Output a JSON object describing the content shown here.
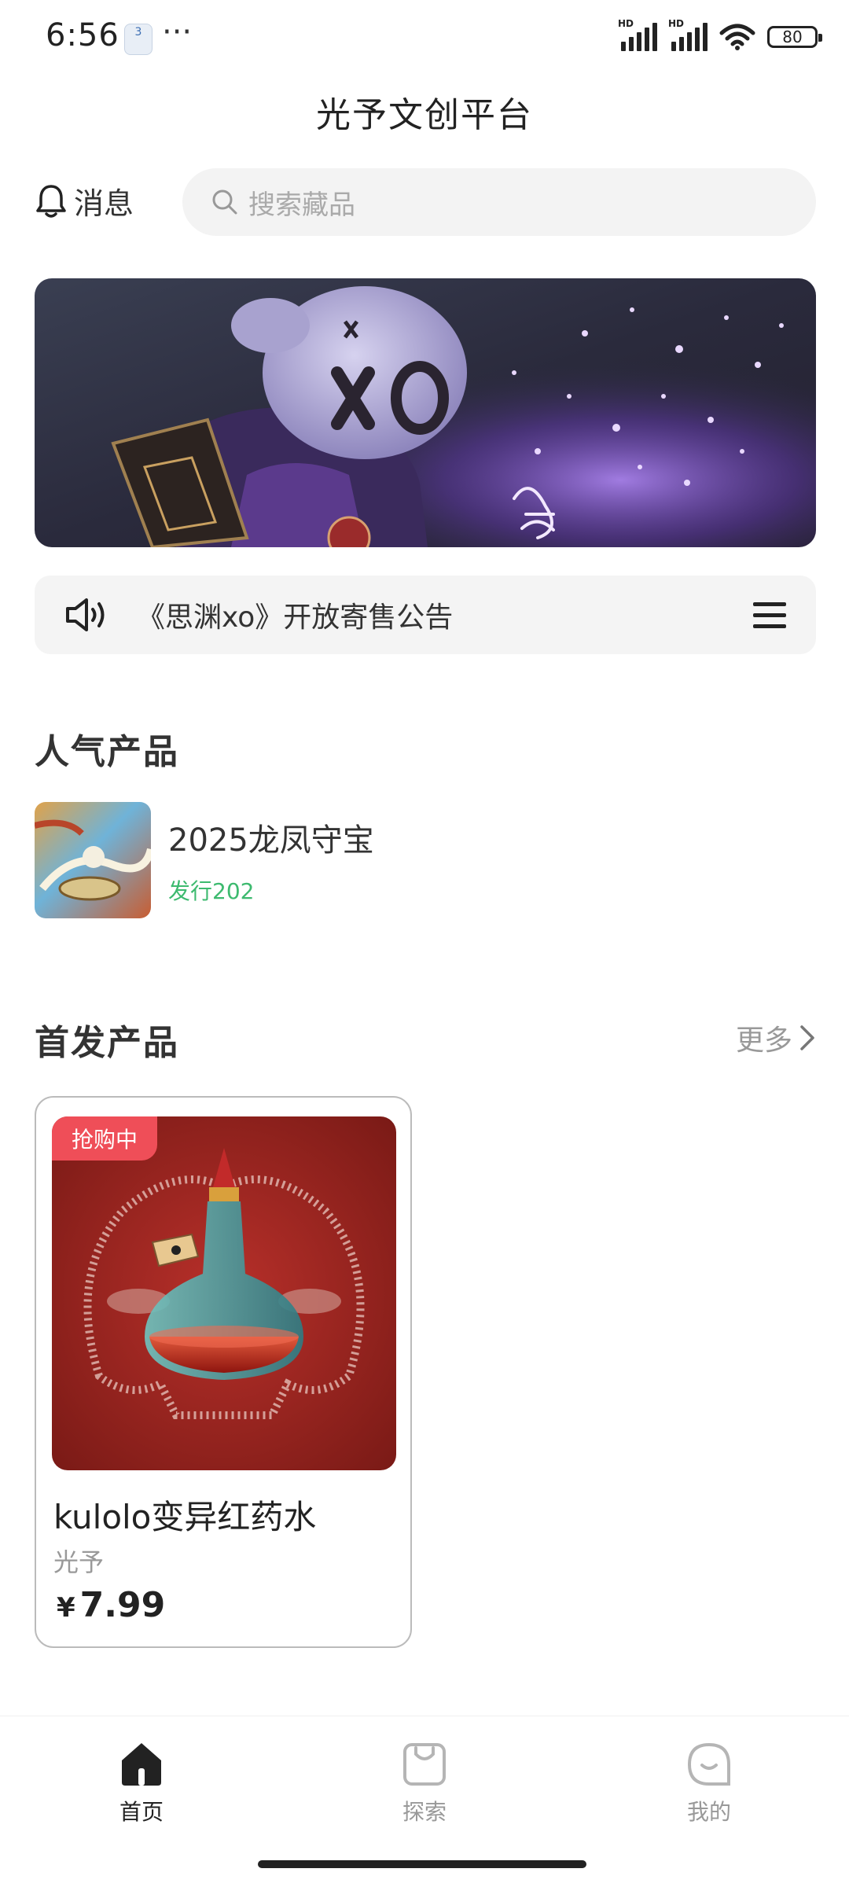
{
  "status_bar": {
    "time": "6:56",
    "notification_badge": "3",
    "overflow": "···",
    "signal_1_label": "HD",
    "signal_2_label": "HD",
    "battery": "80"
  },
  "app": {
    "title": "光予文创平台"
  },
  "header": {
    "message_label": "消息",
    "search_placeholder": "搜索藏品"
  },
  "notice": {
    "text": "《思渊xo》开放寄售公告"
  },
  "popular": {
    "title": "人气产品",
    "items": [
      {
        "name": "2025龙凤守宝",
        "issue": "发行202"
      }
    ]
  },
  "first_release": {
    "title": "首发产品",
    "more_label": "更多",
    "items": [
      {
        "badge": "抢购中",
        "name": "kulolo变异红药水",
        "brand": "光予",
        "currency": "¥",
        "price": "7.99"
      }
    ]
  },
  "bottom_nav": {
    "items": [
      {
        "label": "首页",
        "active": true
      },
      {
        "label": "探索",
        "active": false
      },
      {
        "label": "我的",
        "active": false
      }
    ]
  },
  "colors": {
    "accent_green": "#3dba6f",
    "badge_red": "#ef4e58",
    "text_dark": "#222222",
    "text_muted": "#999999",
    "nav_inactive": "#b5b5b5"
  }
}
